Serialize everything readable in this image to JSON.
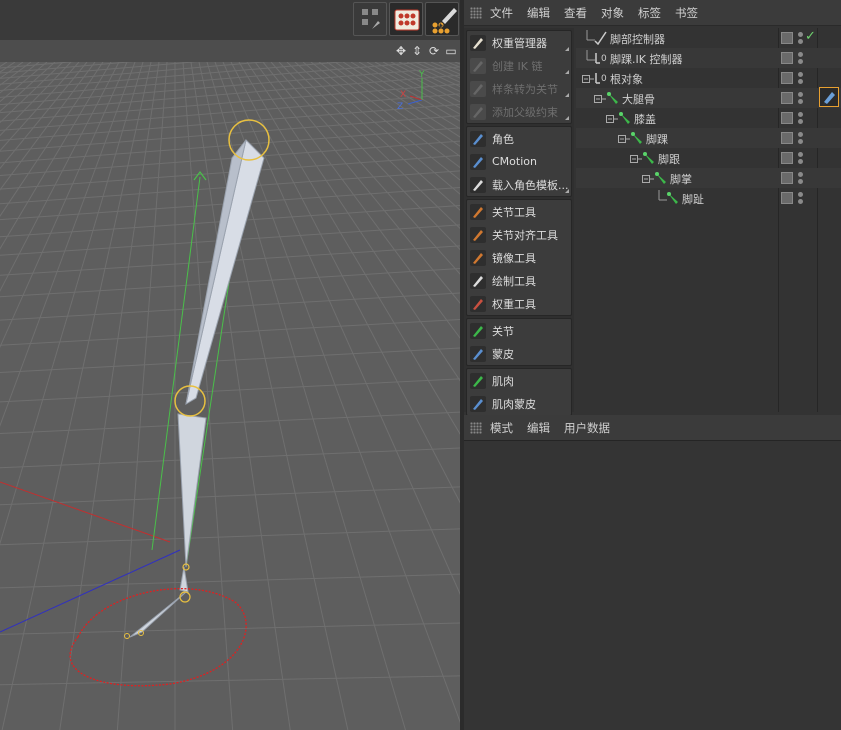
{
  "app": {
    "accent": "#5bc8f5"
  },
  "viewport": {
    "axis_labels": {
      "x": "X",
      "y": "Y",
      "z": "Z"
    },
    "toolbar_icons": [
      "snap-icon",
      "weight-manager-icon",
      "paint-icon"
    ],
    "nav_icons": [
      "move-icon",
      "pan-icon",
      "rotate-icon",
      "maximize-icon"
    ]
  },
  "object_manager": {
    "menu": [
      "文件",
      "编辑",
      "查看",
      "对象",
      "标签",
      "书签"
    ],
    "objects": [
      {
        "name": "脚部控制器",
        "indent": 0,
        "tree": "",
        "icon": "spline-icon"
      },
      {
        "name": "脚踝.IK 控制器",
        "indent": 0,
        "tree": "",
        "icon": "null-icon"
      },
      {
        "name": "根对象",
        "indent": 0,
        "tree": "-",
        "icon": "null-icon"
      },
      {
        "name": "大腿骨",
        "indent": 1,
        "tree": "-",
        "icon": "joint-icon"
      },
      {
        "name": "膝盖",
        "indent": 2,
        "tree": "-",
        "icon": "joint-icon"
      },
      {
        "name": "脚踝",
        "indent": 3,
        "tree": "-",
        "icon": "joint-icon"
      },
      {
        "name": "脚跟",
        "indent": 4,
        "tree": "-",
        "icon": "joint-icon"
      },
      {
        "name": "脚掌",
        "indent": 5,
        "tree": "-",
        "icon": "joint-icon"
      },
      {
        "name": "脚趾",
        "indent": 6,
        "tree": "",
        "icon": "joint-icon"
      }
    ]
  },
  "palette": {
    "groups": [
      {
        "items": [
          {
            "label": "权重管理器",
            "icon": "weight-manager-icon",
            "disabled": false,
            "tri": true
          },
          {
            "label": "创建 IK 链",
            "icon": "ik-chain-icon",
            "disabled": true,
            "tri": true
          },
          {
            "label": "样条转为关节",
            "icon": "spline-to-joint-icon",
            "disabled": true,
            "tri": true
          },
          {
            "label": "添加父级约束",
            "icon": "parent-constraint-icon",
            "disabled": true,
            "tri": true
          }
        ]
      },
      {
        "items": [
          {
            "label": "角色",
            "icon": "character-icon",
            "disabled": false,
            "tri": false
          },
          {
            "label": "CMotion",
            "icon": "cmotion-icon",
            "disabled": false,
            "tri": false
          },
          {
            "label": "载入角色模板...",
            "icon": "load-template-icon",
            "disabled": false,
            "tri": true
          }
        ]
      },
      {
        "items": [
          {
            "label": "关节工具",
            "icon": "joint-tool-icon",
            "disabled": false,
            "tri": false
          },
          {
            "label": "关节对齐工具",
            "icon": "joint-align-icon",
            "disabled": false,
            "tri": false
          },
          {
            "label": "镜像工具",
            "icon": "mirror-tool-icon",
            "disabled": false,
            "tri": false
          },
          {
            "label": "绘制工具",
            "icon": "paint-tool-icon",
            "disabled": false,
            "tri": false
          },
          {
            "label": "权重工具",
            "icon": "weight-tool-icon",
            "disabled": false,
            "tri": false
          }
        ]
      },
      {
        "items": [
          {
            "label": "关节",
            "icon": "joint-icon",
            "disabled": false,
            "tri": false
          },
          {
            "label": "蒙皮",
            "icon": "skin-icon",
            "disabled": false,
            "tri": false
          }
        ]
      },
      {
        "items": [
          {
            "label": "肌肉",
            "icon": "muscle-icon",
            "disabled": false,
            "tri": false
          },
          {
            "label": "肌肉蒙皮",
            "icon": "muscle-skin-icon",
            "disabled": false,
            "tri": false
          }
        ]
      }
    ]
  },
  "attributes": {
    "menu": [
      "模式",
      "编辑",
      "用户数据"
    ]
  }
}
